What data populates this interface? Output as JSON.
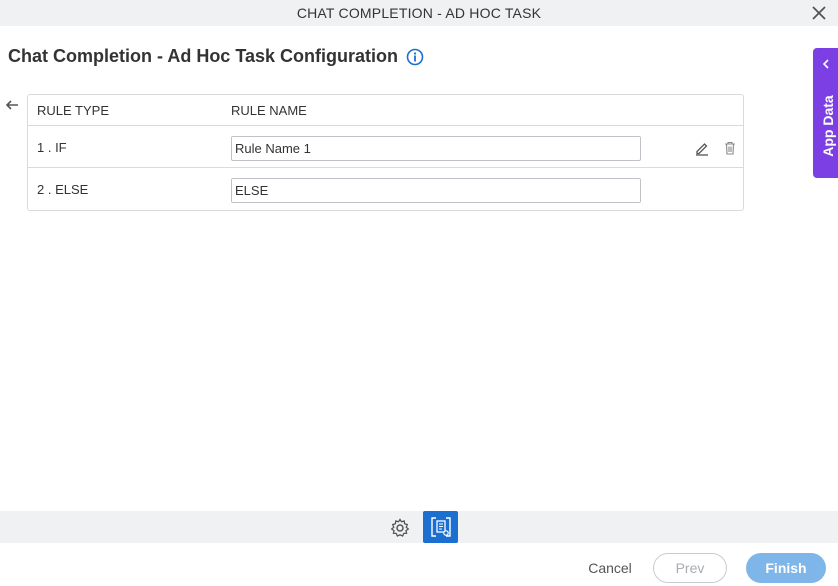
{
  "window": {
    "title": "CHAT COMPLETION - AD HOC TASK"
  },
  "page": {
    "heading": "Chat Completion - Ad Hoc Task Configuration"
  },
  "table": {
    "headers": {
      "rule_type": "RULE TYPE",
      "rule_name": "RULE NAME"
    },
    "rows": [
      {
        "type": "1 . IF",
        "name": "Rule Name 1"
      },
      {
        "type": "2 . ELSE",
        "name": "ELSE"
      }
    ]
  },
  "side_panel": {
    "label": "App Data"
  },
  "footer": {
    "cancel": "Cancel",
    "prev": "Prev",
    "finish": "Finish"
  },
  "colors": {
    "accent": "#7b3fe4",
    "primary": "#1a6fd1",
    "finish_disabled": "#7fb6ea"
  },
  "icons": [
    "close-icon",
    "info-icon",
    "back-arrow-icon",
    "edit-icon",
    "trash-icon",
    "chevron-left-icon",
    "gear-icon",
    "data-source-icon"
  ]
}
